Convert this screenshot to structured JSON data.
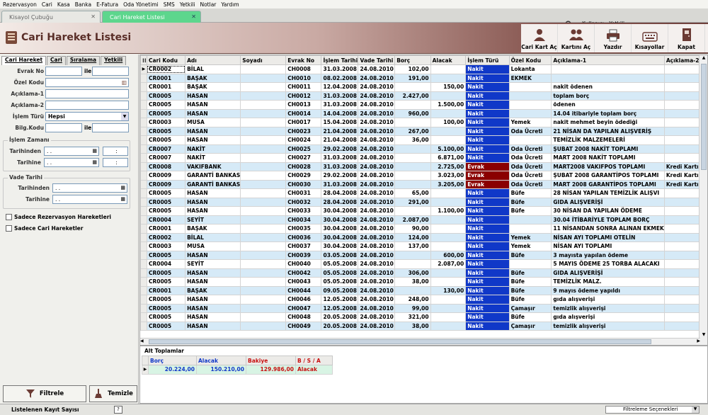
{
  "menu": [
    "Rezervasyon",
    "Cari",
    "Kasa",
    "Banka",
    "E-Fatura",
    "Oda Yönetimi",
    "SMS",
    "Yetkili",
    "Notlar",
    "Yardım"
  ],
  "tabs": [
    {
      "label": "Kisayol Çubuğu"
    },
    {
      "label": "Cari Hareket Listesi"
    }
  ],
  "user_label": "Kullanıcı : Yetkili",
  "page_title": "Cari Hareket Listesi",
  "toolbar": [
    {
      "label": "Cari Kart Aç",
      "icon": "person-card-icon"
    },
    {
      "label": "Kartını Aç",
      "icon": "people-icon"
    },
    {
      "label": "Yazdır",
      "icon": "printer-icon"
    },
    {
      "label": "Kısayollar",
      "icon": "keyboard-icon"
    },
    {
      "label": "Kapat",
      "icon": "close-door-icon"
    }
  ],
  "left_tabs": [
    "Cari Hareket",
    "Cari",
    "Sıralama",
    "Yetkili"
  ],
  "filters": {
    "evrak_no": "Evrak No",
    "ile": "ile",
    "ozel_kodu": "Özel Kodu",
    "aciklama1": "Açıklama-1",
    "aciklama2": "Açıklama-2",
    "islem_turu": "İşlem Türü",
    "islem_turu_value": "Hepsi",
    "bilg_kodu": "Bilg.Kodu",
    "ile2": "ile",
    "islem_zamani": "İşlem Zamanı",
    "tarihinden": "Tarihinden",
    "tarihine": "Tarihine",
    "date_placeholder": ". .",
    "time_placeholder": ":",
    "vade_tarihi": "Vade Tarihi",
    "vade_tarihinden": "Tarihinden",
    "vade_tarihine": "Tarihine",
    "chk_rez": "Sadece Rezervasyon Hareketleri",
    "chk_cari": "Sadece Cari Hareketler"
  },
  "buttons": {
    "filtrele": "Filtrele",
    "temizle": "Temizle"
  },
  "grid": {
    "columns": [
      "Cari Kodu",
      "Adı",
      "Soyadı",
      "Evrak No",
      "İşlem Tarihi",
      "Vade Tarihi",
      "Borç",
      "Alacak",
      "İşlem Türü",
      "Özel Kodu",
      "Açıklama-1",
      "Açıklama-2"
    ],
    "rows": [
      [
        "CR0002",
        "BİLAL",
        "",
        "CH0008",
        "31.03.2008",
        "24.08.2010",
        "102,00",
        "",
        "Nakit",
        "Lokanta",
        "",
        ""
      ],
      [
        "CR0001",
        "BAŞAK",
        "",
        "CH0010",
        "08.02.2008",
        "24.08.2010",
        "191,00",
        "",
        "Nakit",
        "EKMEK",
        "",
        ""
      ],
      [
        "CR0001",
        "BAŞAK",
        "",
        "CH0011",
        "12.04.2008",
        "24.08.2010",
        "",
        "150,00",
        "Nakit",
        "",
        "nakit ödenen",
        ""
      ],
      [
        "CR0005",
        "HASAN",
        "",
        "CH0012",
        "31.03.2008",
        "24.08.2010",
        "2.427,00",
        "",
        "Nakit",
        "",
        "toplam borç",
        ""
      ],
      [
        "CR0005",
        "HASAN",
        "",
        "CH0013",
        "31.03.2008",
        "24.08.2010",
        "",
        "1.500,00",
        "Nakit",
        "",
        "ödenen",
        ""
      ],
      [
        "CR0005",
        "HASAN",
        "",
        "CH0014",
        "14.04.2008",
        "24.08.2010",
        "960,00",
        "",
        "Nakit",
        "",
        "14.04 itibariyle toplam borç",
        ""
      ],
      [
        "CR0003",
        "MUSA",
        "",
        "CH0017",
        "15.04.2008",
        "24.08.2010",
        "",
        "100,00",
        "Nakit",
        "Yemek",
        "nakit mehmet beyin ödediği",
        ""
      ],
      [
        "CR0005",
        "HASAN",
        "",
        "CH0023",
        "21.04.2008",
        "24.08.2010",
        "267,00",
        "",
        "Nakit",
        "Oda Ücreti",
        "21 NİSAN DA YAPILAN ALIŞVERİŞ",
        ""
      ],
      [
        "CR0005",
        "HASAN",
        "",
        "CH0024",
        "21.04.2008",
        "24.08.2010",
        "36,00",
        "",
        "Nakit",
        "",
        "TEMİZLİK MALZEMELERİ",
        ""
      ],
      [
        "CR0007",
        "NAKİT",
        "",
        "CH0025",
        "29.02.2008",
        "24.08.2010",
        "",
        "5.100,00",
        "Nakit",
        "Oda Ücreti",
        "ŞUBAT 2008 NAKİT TOPLAMI",
        ""
      ],
      [
        "CR0007",
        "NAKİT",
        "",
        "CH0027",
        "31.03.2008",
        "24.08.2010",
        "",
        "6.871,00",
        "Nakit",
        "Oda Ücreti",
        "MART 2008  NAKİT TOPLAMI",
        ""
      ],
      [
        "CR0008",
        "VAKIFBANK",
        "",
        "CH0028",
        "31.03.2008",
        "24.08.2010",
        "",
        "2.725,00",
        "Evrak",
        "Oda Ücreti",
        "MART2008 VAKIFPOS TOPLAMI",
        "Kredi Kartı"
      ],
      [
        "CR0009",
        "GARANTİ BANKAS",
        "",
        "CH0029",
        "29.02.2008",
        "24.08.2010",
        "",
        "3.023,00",
        "Evrak",
        "Oda Ücreti",
        "ŞUBAT 2008 GARANTİPOS TOPLAMI",
        "Kredi Kartı"
      ],
      [
        "CR0009",
        "GARANTİ BANKAS",
        "",
        "CH0030",
        "31.03.2008",
        "24.08.2010",
        "",
        "3.205,00",
        "Evrak",
        "Oda Ücreti",
        "MART 2008 GARANTİPOS TOPLAMI",
        "Kredi Kartı"
      ],
      [
        "CR0005",
        "HASAN",
        "",
        "CH0031",
        "28.04.2008",
        "24.08.2010",
        "65,00",
        "",
        "Nakit",
        "Büfe",
        "28 NİSAN YAPILAN TEMİZLİK ALIŞVI",
        ""
      ],
      [
        "CR0005",
        "HASAN",
        "",
        "CH0032",
        "28.04.2008",
        "24.08.2010",
        "291,00",
        "",
        "Nakit",
        "Büfe",
        "GIDA ALIŞVERİŞİ",
        ""
      ],
      [
        "CR0005",
        "HASAN",
        "",
        "CH0033",
        "30.04.2008",
        "24.08.2010",
        "",
        "1.100,00",
        "Nakit",
        "Büfe",
        "30 NİSAN DA YAPILAN ÖDEME",
        ""
      ],
      [
        "CR0004",
        "SEYİT",
        "",
        "CH0034",
        "30.04.2008",
        "24.08.2010",
        "2.087,00",
        "",
        "Nakit",
        "",
        "30.04 İTİBARİYLE TOPLAM BORÇ",
        ""
      ],
      [
        "CR0001",
        "BAŞAK",
        "",
        "CH0035",
        "30.04.2008",
        "24.08.2010",
        "90,00",
        "",
        "Nakit",
        "",
        "11 NİSANDAN SONRA ALINAN EKMEK",
        ""
      ],
      [
        "CR0002",
        "BİLAL",
        "",
        "CH0036",
        "30.04.2008",
        "24.08.2010",
        "124,00",
        "",
        "Nakit",
        "Yemek",
        "NİSAN AYI TOPLAMI OTELİN",
        ""
      ],
      [
        "CR0003",
        "MUSA",
        "",
        "CH0037",
        "30.04.2008",
        "24.08.2010",
        "137,00",
        "",
        "Nakit",
        "Yemek",
        "NİSAN AYI TOPLAMI",
        ""
      ],
      [
        "CR0005",
        "HASAN",
        "",
        "CH0039",
        "03.05.2008",
        "24.08.2010",
        "",
        "600,00",
        "Nakit",
        "Büfe",
        "3 mayısta yapılan ödeme",
        ""
      ],
      [
        "CR0004",
        "SEYİT",
        "",
        "CH0040",
        "05.05.2008",
        "24.08.2010",
        "",
        "2.087,00",
        "Nakit",
        "",
        "5 MAYIS ÖDEME 25 TORBA ALACAKI",
        ""
      ],
      [
        "CR0005",
        "HASAN",
        "",
        "CH0042",
        "05.05.2008",
        "24.08.2010",
        "306,00",
        "",
        "Nakit",
        "Büfe",
        "GIDA ALIŞVERİŞİ",
        ""
      ],
      [
        "CR0005",
        "HASAN",
        "",
        "CH0043",
        "05.05.2008",
        "24.08.2010",
        "38,00",
        "",
        "Nakit",
        "Büfe",
        "TEMİZLİK MALZ.",
        ""
      ],
      [
        "CR0001",
        "BAŞAK",
        "",
        "CH0044",
        "09.05.2008",
        "24.08.2010",
        "",
        "130,00",
        "Nakit",
        "Büfe",
        "9 mayıs ödeme yapıldı",
        ""
      ],
      [
        "CR0005",
        "HASAN",
        "",
        "CH0046",
        "12.05.2008",
        "24.08.2010",
        "248,00",
        "",
        "Nakit",
        "Büfe",
        "gıda alışverişi",
        ""
      ],
      [
        "CR0005",
        "HASAN",
        "",
        "CH0047",
        "12.05.2008",
        "24.08.2010",
        "99,00",
        "",
        "Nakit",
        "Çamaşır",
        "temizlik alışverişi",
        ""
      ],
      [
        "CR0005",
        "HASAN",
        "",
        "CH0048",
        "20.05.2008",
        "24.08.2010",
        "321,00",
        "",
        "Nakit",
        "Büfe",
        "gıda alışverişi",
        ""
      ],
      [
        "CR0005",
        "HASAN",
        "",
        "CH0049",
        "20.05.2008",
        "24.08.2010",
        "38,00",
        "",
        "Nakit",
        "Çamaşır",
        "temizlik alışverişi",
        ""
      ]
    ]
  },
  "alt_toplamlar": {
    "title": "Alt Toplamlar",
    "columns": [
      "Borç",
      "Alacak",
      "Bakiye",
      "B / S / A"
    ],
    "values": [
      "20.224,00",
      "150.210,00",
      "129.986,00",
      "Alacak"
    ]
  },
  "status": {
    "label": "Listelenen Kayıt Sayısı",
    "help": "?",
    "filter_options": "Filtreleme Seçenekleri"
  },
  "colors": {
    "nakit": "#1038c8",
    "evrak": "#8a0000",
    "row_alt": "#d6eaf7",
    "active_tab": "#5dd68d"
  }
}
